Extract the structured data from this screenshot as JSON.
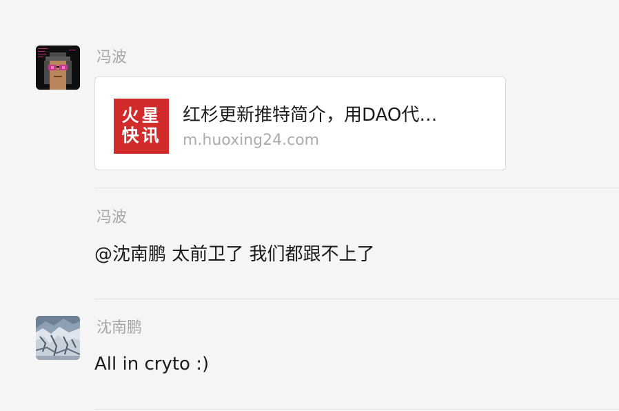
{
  "messages": [
    {
      "sender": "冯波",
      "avatar": "pixel-punk-avatar",
      "link_card": {
        "title": "红杉更新推特简介，用DAO代…",
        "url": "m.huoxing24.com",
        "logo_text": [
          "火",
          "星",
          "快",
          "讯"
        ],
        "logo_color": "#d22b2b"
      }
    },
    {
      "sender": "冯波",
      "text": "@沈南鹏 太前卫了 我们都跟不上了"
    },
    {
      "sender": "沈南鹏",
      "avatar": "snow-mountain-avatar",
      "text": "All in cryto :)"
    }
  ]
}
